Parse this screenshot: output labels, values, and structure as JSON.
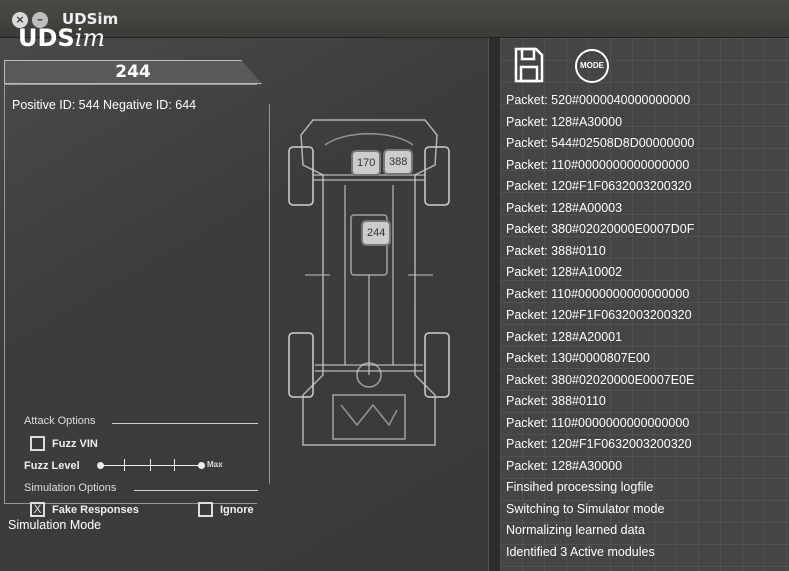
{
  "window": {
    "title": "UDSim",
    "close_glyph": "×",
    "min_glyph": "–"
  },
  "logo": {
    "main": "UDS",
    "sub": "im"
  },
  "selected_id": "244",
  "info": {
    "positive_negative": "Positive ID: 544 Negative ID: 644"
  },
  "attack_options": {
    "label": "Attack Options",
    "fuzz_vin": {
      "label": "Fuzz VIN",
      "checked": false,
      "mark": ""
    },
    "fuzz_level": {
      "label": "Fuzz Level",
      "max_label": "Max"
    }
  },
  "simulation_options": {
    "label": "Simulation Options",
    "fake_responses": {
      "label": "Fake Responses",
      "checked": true,
      "mark": "X"
    },
    "ignore": {
      "label": "Ignore",
      "checked": false,
      "mark": ""
    }
  },
  "status": "Simulation Mode",
  "modules": {
    "m170": "170",
    "m388": "388",
    "m244": "244"
  },
  "toolbar": {
    "mode_label": "MODE",
    "save_icon": "floppy-disk-icon"
  },
  "log": [
    "Packet: 520#0000040000000000",
    "Packet: 128#A30000",
    "Packet: 544#02508D8D00000000",
    "Packet: 110#0000000000000000",
    "Packet: 120#F1F0632003200320",
    "Packet: 128#A00003",
    "Packet: 380#02020000E0007D0F",
    "Packet: 388#0110",
    "Packet: 128#A10002",
    "Packet: 110#0000000000000000",
    "Packet: 120#F1F0632003200320",
    "Packet: 128#A20001",
    "Packet: 130#0000807E00",
    "Packet: 380#02020000E0007E0E",
    "Packet: 388#0110",
    "Packet: 110#0000000000000000",
    "Packet: 120#F1F0632003200320",
    "Packet: 128#A30000",
    "Finsihed processing logfile",
    "Switching to Simulator mode",
    "Normalizing learned data",
    "Identified 3 Active modules"
  ]
}
